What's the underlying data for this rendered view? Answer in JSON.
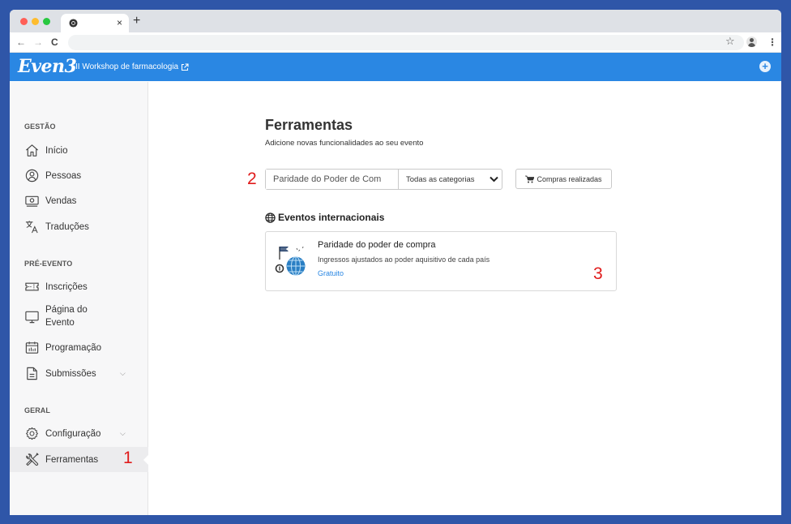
{
  "browser": {
    "tab_close": "×",
    "new_tab": "+",
    "back": "←",
    "forward": "→",
    "reload": "C",
    "star": "☆",
    "menu": "⋮"
  },
  "app": {
    "logo": "Even3",
    "event_title": "II Workshop de farmacologia",
    "add": "+",
    "accent_color": "#2a87e3"
  },
  "sidebar": {
    "sections": [
      {
        "title": "GESTÃO",
        "items": [
          {
            "label": "Início",
            "icon": "home-icon"
          },
          {
            "label": "Pessoas",
            "icon": "user-circle-icon"
          },
          {
            "label": "Vendas",
            "icon": "money-icon"
          },
          {
            "label": "Traduções",
            "icon": "translate-icon"
          }
        ]
      },
      {
        "title": "PRÉ-EVENTO",
        "items": [
          {
            "label": "Inscrições",
            "icon": "ticket-icon"
          },
          {
            "label": "Página do",
            "label2": "Evento",
            "icon": "monitor-icon"
          },
          {
            "label": "Programação",
            "icon": "calendar-icon"
          },
          {
            "label": "Submissões",
            "icon": "document-icon",
            "chevron": "⌵"
          }
        ]
      },
      {
        "title": "GERAL",
        "items": [
          {
            "label": "Configuração",
            "icon": "gear-icon",
            "chevron": "⌵"
          },
          {
            "label": "Ferramentas",
            "icon": "tools-icon",
            "active": true
          }
        ]
      }
    ]
  },
  "annotations": [
    "1",
    "2",
    "3"
  ],
  "main": {
    "title": "Ferramentas",
    "subtitle": "Adicione novas funcionalidades ao seu evento",
    "search_value": "Paridade do Poder de Com",
    "category_select": "Todas as categorias",
    "purchases_button": "Compras realizadas",
    "category_heading": "Eventos internacionais",
    "tools": [
      {
        "name": "Paridade do poder de compra",
        "description": "Ingressos ajustados ao poder aquisitivo de cada país",
        "price": "Gratuito"
      }
    ]
  }
}
